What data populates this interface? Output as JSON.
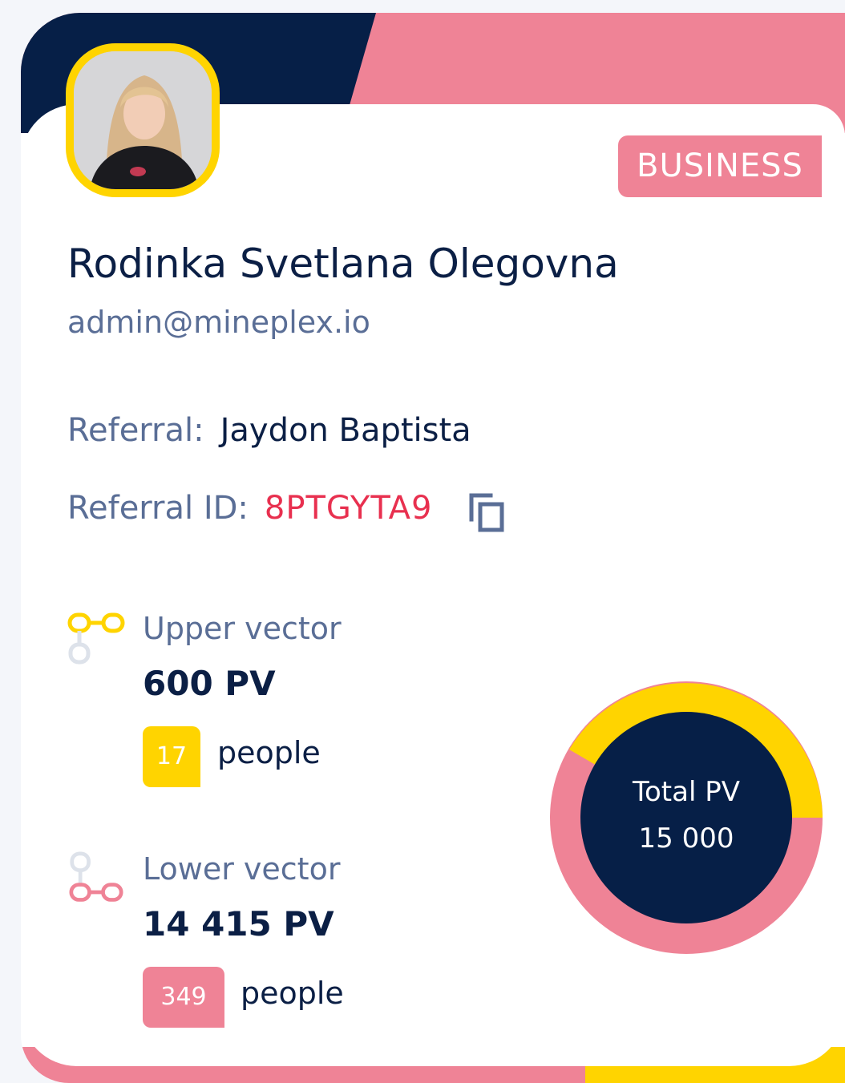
{
  "profile": {
    "name": "Rodinka Svetlana Olegovna",
    "email": "admin@mineplex.io",
    "status_badge": "BUSINESS"
  },
  "referral": {
    "label": "Referral:",
    "name": "Jaydon Baptista",
    "id_label": "Referral ID:",
    "id_value": "8PTGYTA9"
  },
  "upper_vector": {
    "label": "Upper vector",
    "value": "600 PV",
    "people_count": "17",
    "people_label": "people"
  },
  "lower_vector": {
    "label": "Lower vector",
    "value": "14 415 PV",
    "people_count": "349",
    "people_label": "people"
  },
  "total": {
    "label": "Total PV",
    "value": "15 000"
  },
  "colors": {
    "navy": "#0b1f45",
    "pink": "#ef8396",
    "yellow": "#ffd400",
    "referral_id": "#e8304f",
    "muted": "#5a6e96"
  },
  "icons": {
    "copy": "copy-icon",
    "upper": "upper-vector-link-icon",
    "lower": "lower-vector-link-icon"
  }
}
